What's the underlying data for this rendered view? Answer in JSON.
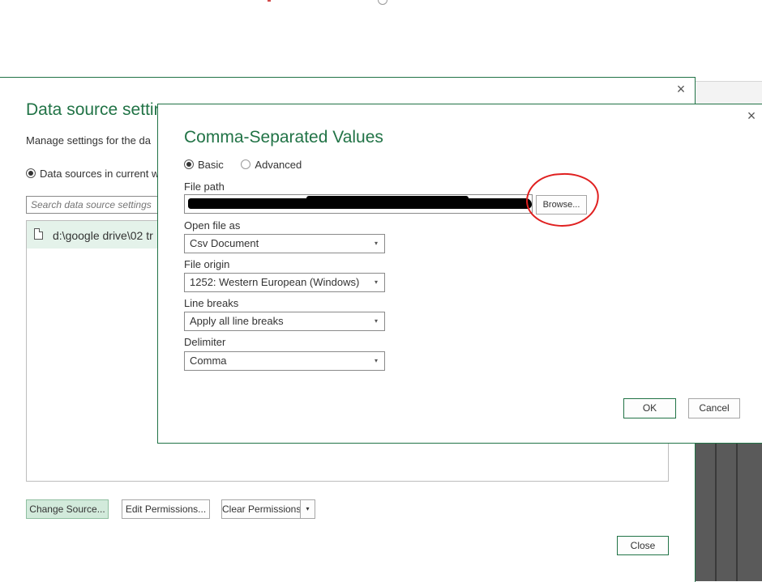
{
  "background": {
    "accent_color": "#217346",
    "annotation_color": "#e02020"
  },
  "data_source_settings": {
    "title": "Data source settin",
    "description": "Manage settings for the da",
    "scope_radio_label": "Data sources in current wo",
    "search_placeholder": "Search data source settings",
    "list_items": [
      {
        "icon": "document-icon",
        "text": "d:\\google drive\\02 tr"
      }
    ],
    "buttons": {
      "change_source": "Change Source...",
      "edit_permissions": "Edit Permissions...",
      "clear_permissions": "Clear Permissions",
      "clear_permissions_dropdown": "▾",
      "close": "Close"
    },
    "close_icon": "×"
  },
  "csv_dialog": {
    "title": "Comma-Separated Values",
    "close_icon": "×",
    "modes": [
      {
        "label": "Basic",
        "selected": true
      },
      {
        "label": "Advanced",
        "selected": false
      }
    ],
    "file_path_label": "File path",
    "file_path_value": "",
    "browse_label": "Browse...",
    "open_file_as": {
      "label": "Open file as",
      "value": "Csv Document"
    },
    "file_origin": {
      "label": "File origin",
      "value": "1252: Western European (Windows)"
    },
    "line_breaks": {
      "label": "Line breaks",
      "value": "Apply all line breaks"
    },
    "delimiter": {
      "label": "Delimiter",
      "value": "Comma"
    },
    "dropdown_caret": "▾",
    "ok_label": "OK",
    "cancel_label": "Cancel"
  }
}
